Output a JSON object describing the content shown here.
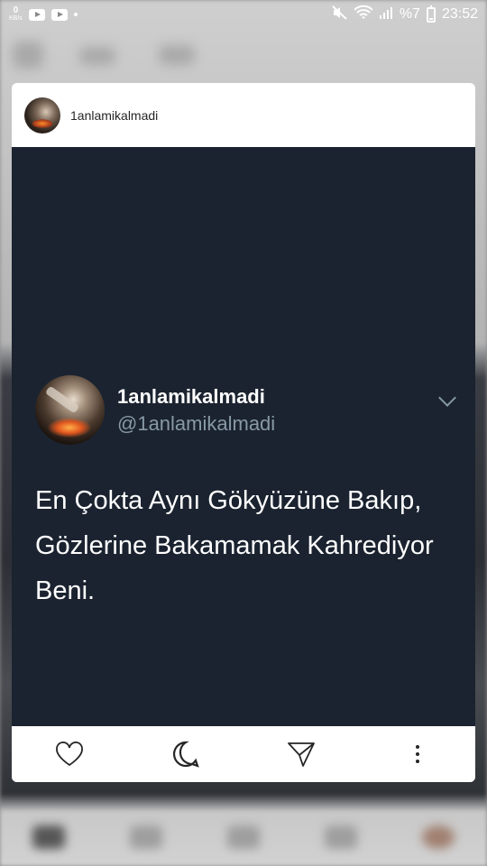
{
  "status_bar": {
    "net_speed_value": "0",
    "net_speed_unit": "KB/s",
    "battery_text": "%7",
    "time": "23:52"
  },
  "post": {
    "username": "1anlamikalmadi",
    "tweet": {
      "display_name": "1anlamikalmadi",
      "handle": "@1anlamikalmadi",
      "text": "En Çokta Aynı Gökyüzüne Bakıp, Gözlerine Bakamamak Kahrediyor Beni."
    },
    "actions": [
      "heart-icon",
      "comment-icon",
      "share-icon",
      "more-icon"
    ]
  },
  "colors": {
    "tweet_bg": "#1b2330",
    "handle": "#8899a6"
  }
}
